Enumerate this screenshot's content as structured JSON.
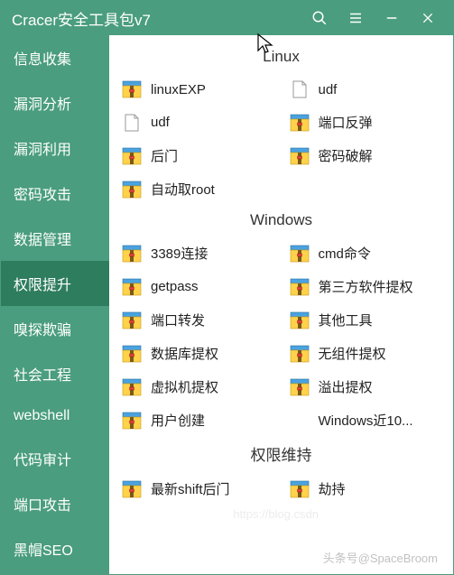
{
  "titlebar": {
    "title": "Cracer安全工具包v7"
  },
  "sidebar": {
    "items": [
      {
        "label": "信息收集"
      },
      {
        "label": "漏洞分析"
      },
      {
        "label": "漏洞利用"
      },
      {
        "label": "密码攻击"
      },
      {
        "label": "数据管理"
      },
      {
        "label": "权限提升",
        "active": true
      },
      {
        "label": "嗅探欺骗"
      },
      {
        "label": "社会工程"
      },
      {
        "label": "webshell"
      },
      {
        "label": "代码审计"
      },
      {
        "label": "端口攻击"
      },
      {
        "label": "黑帽SEO"
      }
    ]
  },
  "sections": [
    {
      "title": "Linux",
      "items": [
        {
          "label": "linuxEXP",
          "icon": "archive"
        },
        {
          "label": "udf",
          "icon": "doc"
        },
        {
          "label": "udf",
          "icon": "doc"
        },
        {
          "label": "端口反弹",
          "icon": "archive"
        },
        {
          "label": "后门",
          "icon": "archive"
        },
        {
          "label": "密码破解",
          "icon": "archive"
        },
        {
          "label": "自动取root",
          "icon": "archive"
        }
      ]
    },
    {
      "title": "Windows",
      "items": [
        {
          "label": "3389连接",
          "icon": "archive"
        },
        {
          "label": "cmd命令",
          "icon": "archive"
        },
        {
          "label": "getpass",
          "icon": "archive"
        },
        {
          "label": "第三方软件提权",
          "icon": "archive"
        },
        {
          "label": "端口转发",
          "icon": "archive"
        },
        {
          "label": "其他工具",
          "icon": "archive"
        },
        {
          "label": "数据库提权",
          "icon": "archive"
        },
        {
          "label": "无组件提权",
          "icon": "archive"
        },
        {
          "label": "虚拟机提权",
          "icon": "archive"
        },
        {
          "label": "溢出提权",
          "icon": "archive"
        },
        {
          "label": "用户创建",
          "icon": "archive"
        },
        {
          "label": "Windows近10...",
          "icon": "none"
        }
      ]
    },
    {
      "title": "权限维持",
      "items": [
        {
          "label": "最新shift后门",
          "icon": "archive"
        },
        {
          "label": "劫持",
          "icon": "archive"
        }
      ]
    }
  ],
  "watermark": "头条号@SpaceBroom",
  "watermark2": "https://blog.csdn"
}
